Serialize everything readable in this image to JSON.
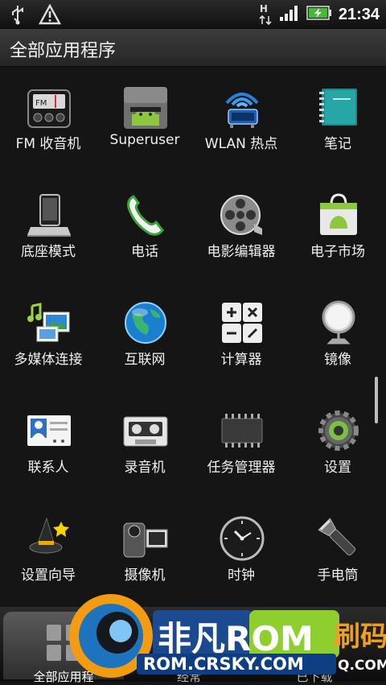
{
  "status_bar": {
    "time": "21:34",
    "network_label": "H"
  },
  "header": {
    "title": "全部应用程序"
  },
  "apps": [
    {
      "label": "FM 收音机",
      "icon": "radio-icon"
    },
    {
      "label": "Superuser",
      "icon": "android-superuser-icon"
    },
    {
      "label": "WLAN 热点",
      "icon": "wifi-hotspot-icon"
    },
    {
      "label": "笔记",
      "icon": "notebook-icon"
    },
    {
      "label": "底座模式",
      "icon": "dock-icon"
    },
    {
      "label": "电话",
      "icon": "phone-icon"
    },
    {
      "label": "电影编辑器",
      "icon": "film-reel-icon"
    },
    {
      "label": "电子市场",
      "icon": "market-bag-icon"
    },
    {
      "label": "多媒体连接",
      "icon": "media-connect-icon"
    },
    {
      "label": "互联网",
      "icon": "globe-icon"
    },
    {
      "label": "计算器",
      "icon": "calculator-icon"
    },
    {
      "label": "镜像",
      "icon": "mirror-icon"
    },
    {
      "label": "联系人",
      "icon": "contacts-card-icon"
    },
    {
      "label": "录音机",
      "icon": "cassette-icon"
    },
    {
      "label": "任务管理器",
      "icon": "chip-icon"
    },
    {
      "label": "设置",
      "icon": "gear-icon"
    },
    {
      "label": "设置向导",
      "icon": "wizard-hat-icon"
    },
    {
      "label": "摄像机",
      "icon": "camcorder-icon"
    },
    {
      "label": "时钟",
      "icon": "clock-icon"
    },
    {
      "label": "手电筒",
      "icon": "flashlight-icon"
    }
  ],
  "bottom_tabs": [
    {
      "label": "全部应用程",
      "icon": "all-apps-grid-icon"
    },
    {
      "label": "经常",
      "icon": "frequent-icon"
    },
    {
      "label": "已下载",
      "icon": "downloaded-icon"
    }
  ],
  "watermark": {
    "brand": "非凡ROM",
    "url": "ROM.CRSKY.COM",
    "side_text": "刷码",
    "side_url": "Q.COM"
  }
}
